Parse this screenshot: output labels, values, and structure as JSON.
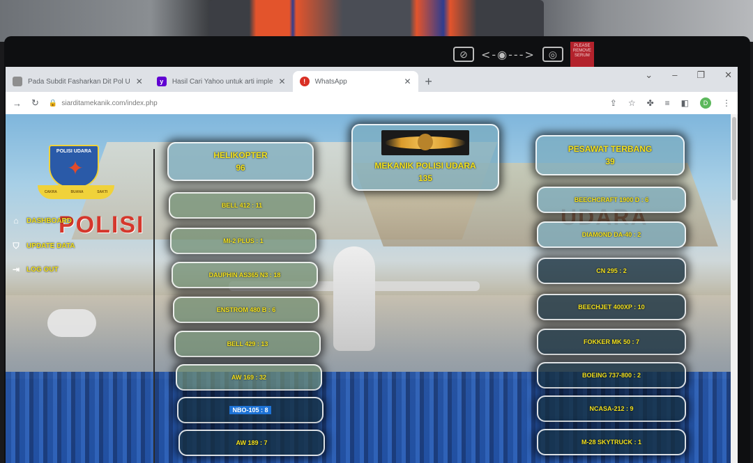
{
  "camera_bar": {
    "note": "PLEASE REMOVE SERUM"
  },
  "browser": {
    "tabs": [
      {
        "label": "Pada Subdit Fasharkan Dit Pol U",
        "icon": "tab-icon",
        "color": "#5f6368"
      },
      {
        "label": "Hasil Cari Yahoo untuk arti imple",
        "icon": "yahoo-icon",
        "color": "#6001d2"
      },
      {
        "label": "WhatsApp",
        "icon": "whatsapp-icon",
        "color": "#d93025"
      }
    ],
    "new_tab": "+",
    "url": "siarditamekanik.com/index.php",
    "avatar": "D"
  },
  "sidebar": {
    "logo_title": "POLISI UDARA",
    "logo_ribbon": [
      "CAKRA",
      "BUANA",
      "SAKTI"
    ],
    "watermark_left": "POLISI",
    "watermark_right": "UDARA",
    "nav": [
      {
        "label": "DASHBOARD",
        "icon": "home-icon"
      },
      {
        "label": "UPDATE DATA",
        "icon": "shield-icon"
      },
      {
        "label": "LOG OUT",
        "icon": "logout-icon"
      }
    ]
  },
  "summary": {
    "helikopter": {
      "label": "HELIKOPTER",
      "count": "96"
    },
    "mekanik": {
      "label": "MEKANIK POLISI UDARA",
      "count": "135"
    },
    "pesawat": {
      "label": "PESAWAT TERBANG",
      "count": "39"
    }
  },
  "helikopter_items": [
    "BELL 412 : 11",
    "MI-2 PLUS : 1",
    "DAUPHIN AS365 N3 : 18",
    "ENSTROM 480 B : 6",
    "BELL 429 : 13",
    "AW 169 : 32",
    "NBO-105 : 8",
    "AW 189 : 7"
  ],
  "pesawat_items": [
    "BEECHCRAFT 1900 D : 6",
    "DIAMOND DA-40 : 2",
    "CN 295 : 2",
    "BEECHJET 400XP : 10",
    "FOKKER MK 50 : 7",
    "BOEING 737-800 : 2",
    "NCASA-212 : 9",
    "M-28 SKYTRUCK : 1"
  ]
}
